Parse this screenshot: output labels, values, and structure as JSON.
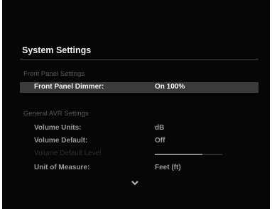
{
  "title": "System Settings",
  "sections": [
    {
      "header": "Front Panel Settings",
      "items": [
        {
          "label": "Front Panel Dimmer:",
          "value": "On 100%"
        }
      ]
    },
    {
      "header": "General AVR Settings",
      "items": [
        {
          "label": "Volume Units:",
          "value": "dB"
        },
        {
          "label": "Volume Default:",
          "value": "Off"
        },
        {
          "label": "Volume Default Level",
          "level_fraction": 0.7
        },
        {
          "label": "Unit of Measure:",
          "value": "Feet (ft)"
        }
      ]
    }
  ],
  "selected_item": "Front Panel Dimmer:",
  "scroll_indicator_icon": "chevron-down-icon",
  "colors": {
    "background": "#060606",
    "selection": "#3a3a3a",
    "text_active": "#f5f5f5",
    "text_normal": "#9a9a9a",
    "text_dim": "#5a5a5a"
  }
}
